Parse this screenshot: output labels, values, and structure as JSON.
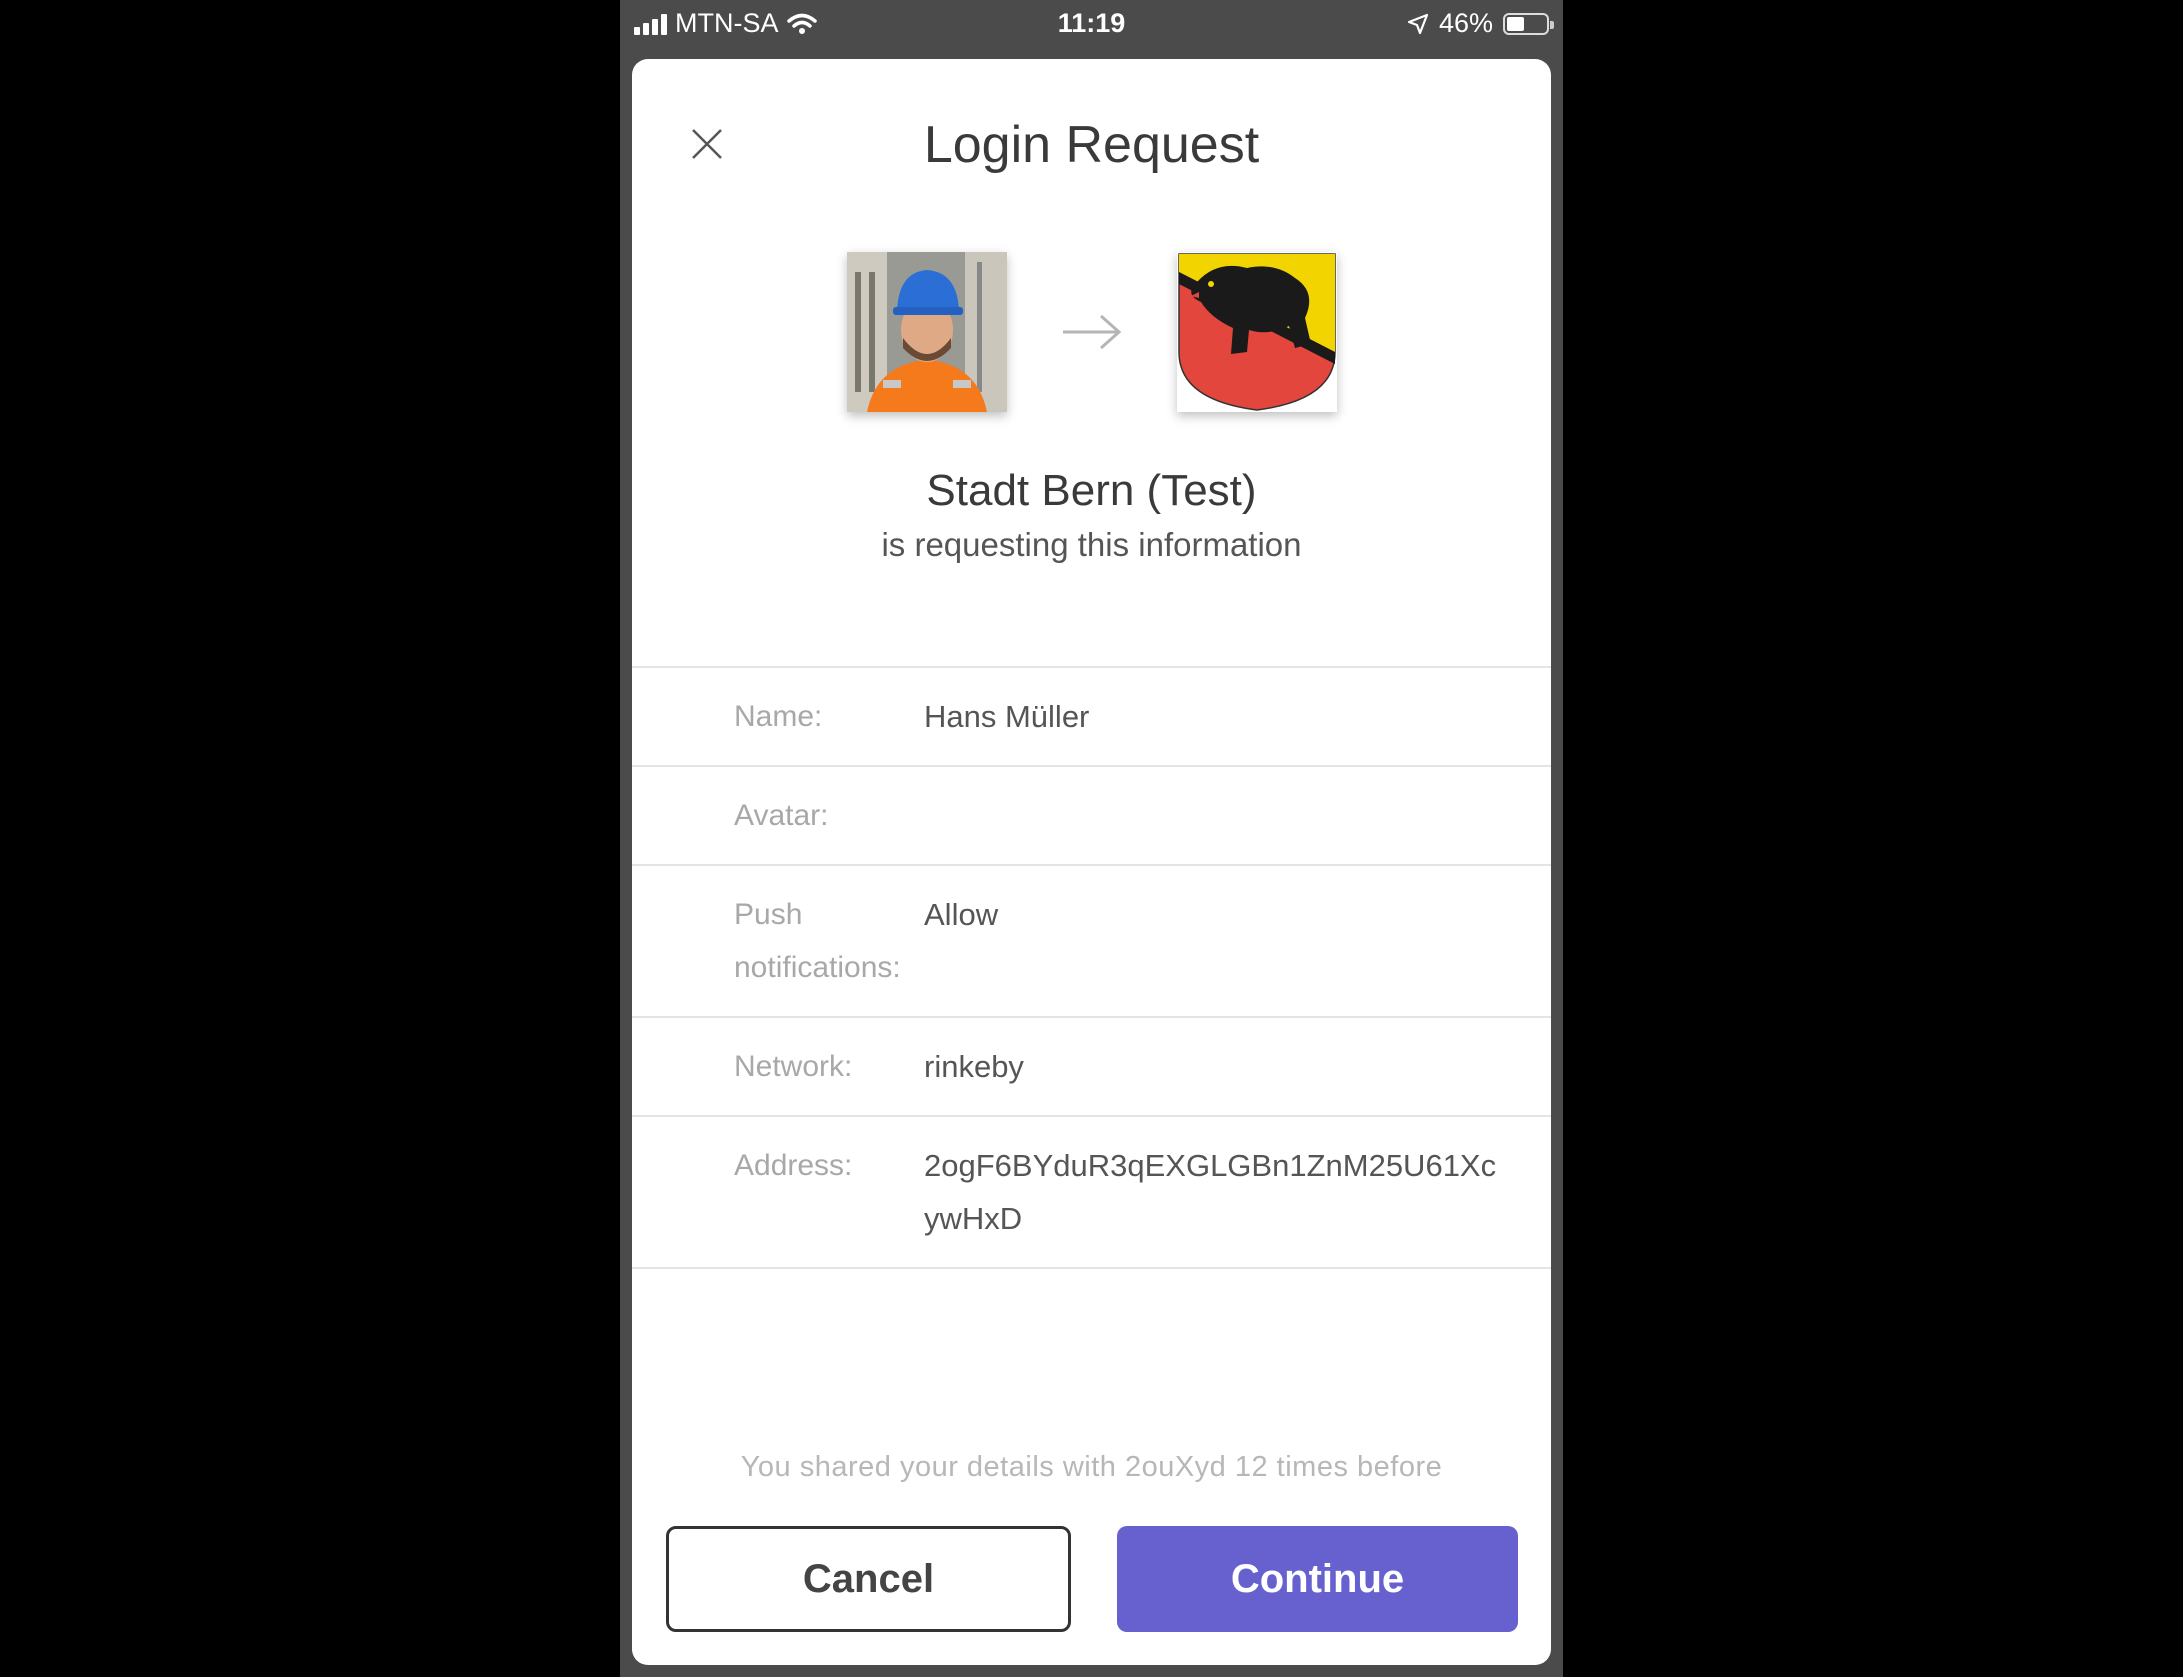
{
  "status_bar": {
    "carrier": "MTN-SA",
    "time": "11:19",
    "battery_percent": "46%",
    "battery_level": 0.46
  },
  "dialog": {
    "title": "Login Request",
    "requester_name": "Stadt Bern (Test)",
    "requester_subtitle": "is requesting this information"
  },
  "fields": [
    {
      "label": "Name:",
      "value": "Hans Müller"
    },
    {
      "label": "Avatar:",
      "value": ""
    },
    {
      "label": "Push notifications:",
      "value": "Allow"
    },
    {
      "label": "Network:",
      "value": "rinkeby"
    },
    {
      "label": "Address:",
      "value": "2ogF6BYduR3qEXGLGBn1ZnM25U61XcywHxD"
    }
  ],
  "footer": {
    "shared_note": "You shared your details with 2ouXyd 12 times before",
    "cancel_label": "Cancel",
    "continue_label": "Continue"
  },
  "colors": {
    "accent": "#6761d0",
    "bern_red": "#e2463c",
    "bern_yellow": "#f2d500"
  }
}
